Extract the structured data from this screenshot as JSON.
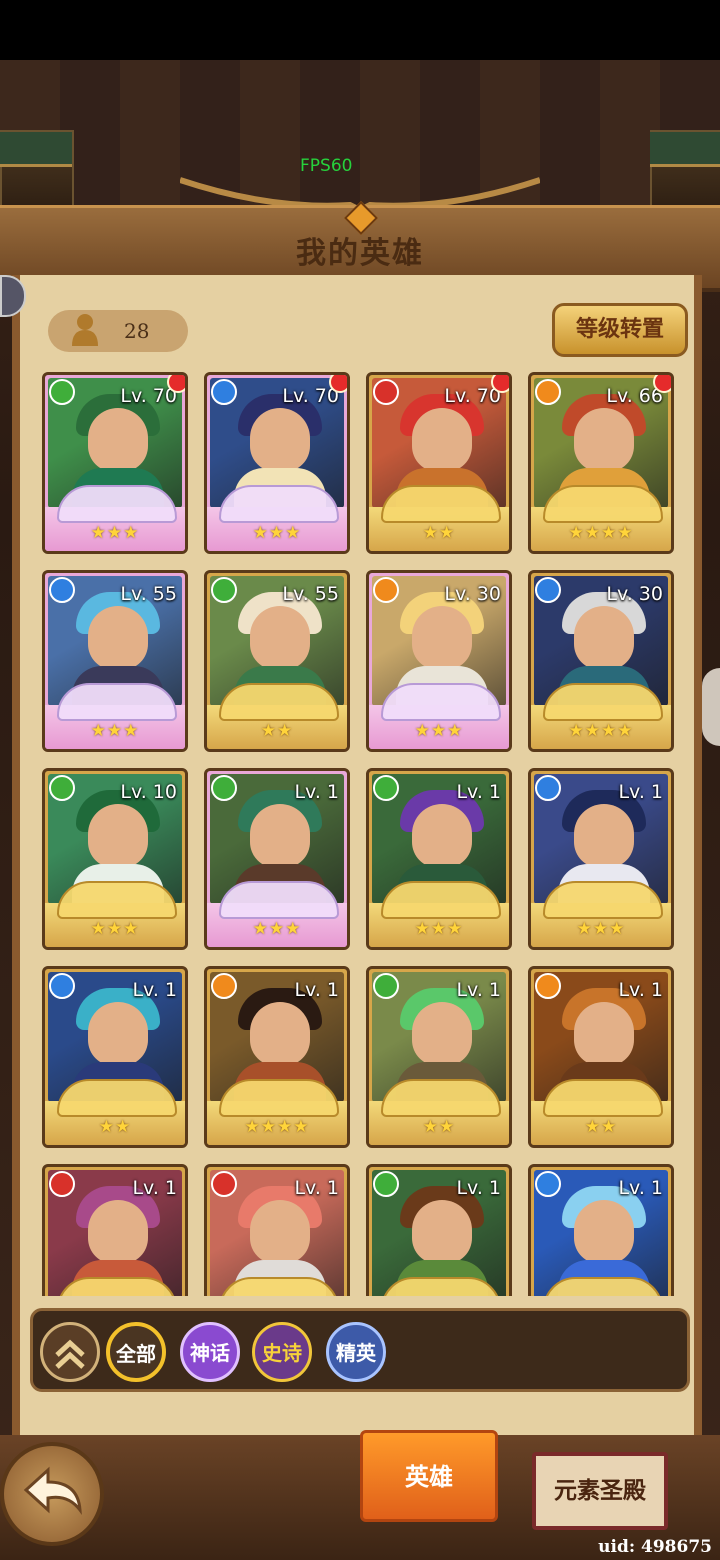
{
  "hud": {
    "fps": "FPS60",
    "uid": "uid: 498675"
  },
  "header": {
    "title": "我的英雄"
  },
  "toolbar": {
    "hero_count": "28",
    "reset_label": "等级转置"
  },
  "heroes": [
    {
      "level": "Lv. 70",
      "element": "wind",
      "stars": "★★★",
      "rarity": "mythic",
      "new": true
    },
    {
      "level": "Lv. 70",
      "element": "water",
      "stars": "★★★",
      "rarity": "mythic",
      "new": true
    },
    {
      "level": "Lv. 70",
      "element": "fire",
      "stars": "★★",
      "rarity": "elite",
      "new": true
    },
    {
      "level": "Lv. 66",
      "element": "earth",
      "stars": "★★★★",
      "rarity": "elite",
      "new": true
    },
    {
      "level": "Lv. 55",
      "element": "water",
      "stars": "★★★",
      "rarity": "mythic",
      "new": false
    },
    {
      "level": "Lv. 55",
      "element": "wind",
      "stars": "★★",
      "rarity": "elite",
      "new": false
    },
    {
      "level": "Lv. 30",
      "element": "earth",
      "stars": "★★★",
      "rarity": "mythic",
      "new": false
    },
    {
      "level": "Lv. 30",
      "element": "water",
      "stars": "★★★★",
      "rarity": "elite",
      "new": false
    },
    {
      "level": "Lv. 10",
      "element": "wind",
      "stars": "★★★",
      "rarity": "elite",
      "new": false
    },
    {
      "level": "Lv. 1",
      "element": "wind",
      "stars": "★★★",
      "rarity": "mythic",
      "new": false
    },
    {
      "level": "Lv. 1",
      "element": "wind",
      "stars": "★★★",
      "rarity": "elite",
      "new": false
    },
    {
      "level": "Lv. 1",
      "element": "water",
      "stars": "★★★",
      "rarity": "elite",
      "new": false
    },
    {
      "level": "Lv. 1",
      "element": "water",
      "stars": "★★",
      "rarity": "elite",
      "new": false
    },
    {
      "level": "Lv. 1",
      "element": "earth",
      "stars": "★★★★",
      "rarity": "elite",
      "new": false
    },
    {
      "level": "Lv. 1",
      "element": "wind",
      "stars": "★★",
      "rarity": "elite",
      "new": false
    },
    {
      "level": "Lv. 1",
      "element": "earth",
      "stars": "★★",
      "rarity": "elite",
      "new": false
    },
    {
      "level": "Lv. 1",
      "element": "fire",
      "stars": "",
      "rarity": "elite",
      "new": false
    },
    {
      "level": "Lv. 1",
      "element": "fire",
      "stars": "",
      "rarity": "elite",
      "new": false
    },
    {
      "level": "Lv. 1",
      "element": "wind",
      "stars": "",
      "rarity": "elite",
      "new": false
    },
    {
      "level": "Lv. 1",
      "element": "water",
      "stars": "",
      "rarity": "elite",
      "new": false
    }
  ],
  "filters": {
    "all": "全部",
    "mythic": "神话",
    "epic": "史诗",
    "elite": "精英"
  },
  "tabs": {
    "heroes": "英雄",
    "temple": "元素圣殿"
  },
  "colors": {
    "wind": "#3fae3a",
    "water": "#2f7fe0",
    "fire": "#d8312a",
    "earth": "#f08a1c",
    "accent": "#ff8a22"
  }
}
